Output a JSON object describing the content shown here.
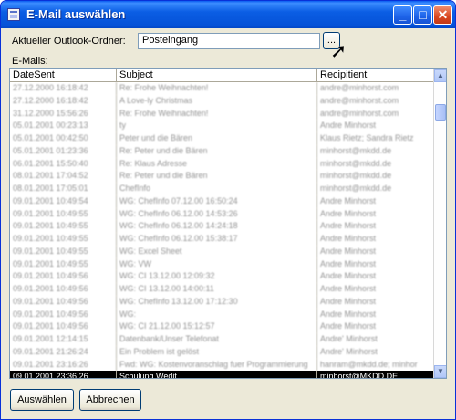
{
  "window": {
    "title": "E-Mail auswählen"
  },
  "captions": {
    "minimize": "_",
    "maximize": "□",
    "close": "✕"
  },
  "folder": {
    "label": "Aktueller Outlook-Ordner:",
    "value": "Posteingang",
    "browse_label": "..."
  },
  "list": {
    "label": "E-Mails:",
    "columns": [
      "DateSent",
      "Subject",
      "Recipitient"
    ],
    "rows": [
      {
        "date": "27.12.2000 16:18:42",
        "subject": "Re: Frohe Weihnachten!",
        "recipient": "andre@minhorst.com"
      },
      {
        "date": "27.12.2000 16:18:42",
        "subject": "A Love-ly Christmas",
        "recipient": "andre@minhorst.com"
      },
      {
        "date": "31.12.2000 15:56:26",
        "subject": "Re: Frohe Weihnachten!",
        "recipient": "andre@minhorst.com"
      },
      {
        "date": "05.01.2001 00:23:13",
        "subject": "ty",
        "recipient": "Andre Minhorst"
      },
      {
        "date": "05.01.2001 00:42:50",
        "subject": "Peter und die Bären",
        "recipient": "Klaus Rietz; Sandra Rietz"
      },
      {
        "date": "05.01.2001 01:23:36",
        "subject": "Re: Peter und die Bären",
        "recipient": "minhorst@mkdd.de"
      },
      {
        "date": "06.01.2001 15:50:40",
        "subject": "Re: Klaus Adresse",
        "recipient": "minhorst@mkdd.de"
      },
      {
        "date": "08.01.2001 17:04:52",
        "subject": "Re: Peter und die Bären",
        "recipient": "minhorst@mkdd.de"
      },
      {
        "date": "08.01.2001 17:05:01",
        "subject": "ChefInfo",
        "recipient": "minhorst@mkdd.de"
      },
      {
        "date": "09.01.2001 10:49:54",
        "subject": "WG: ChefInfo 07.12.00 16:50:24",
        "recipient": "Andre Minhorst"
      },
      {
        "date": "09.01.2001 10:49:55",
        "subject": "WG: ChefInfo 06.12.00 14:53:26",
        "recipient": "Andre Minhorst"
      },
      {
        "date": "09.01.2001 10:49:55",
        "subject": "WG: ChefInfo 06.12.00 14:24:18",
        "recipient": "Andre Minhorst"
      },
      {
        "date": "09.01.2001 10:49:55",
        "subject": "WG: ChefInfo 06.12.00 15:38:17",
        "recipient": "Andre Minhorst"
      },
      {
        "date": "09.01.2001 10:49:55",
        "subject": "WG: Excel Sheet",
        "recipient": "Andre Minhorst"
      },
      {
        "date": "09.01.2001 10:49:55",
        "subject": "WG: VW",
        "recipient": "Andre Minhorst"
      },
      {
        "date": "09.01.2001 10:49:56",
        "subject": "WG: CI 13.12.00 12:09:32",
        "recipient": "Andre Minhorst"
      },
      {
        "date": "09.01.2001 10:49:56",
        "subject": "WG: CI 13.12.00 14:00:11",
        "recipient": "Andre Minhorst"
      },
      {
        "date": "09.01.2001 10:49:56",
        "subject": "WG: ChefInfo 13.12.00 17:12:30",
        "recipient": "Andre Minhorst"
      },
      {
        "date": "09.01.2001 10:49:56",
        "subject": "WG:",
        "recipient": "Andre Minhorst"
      },
      {
        "date": "09.01.2001 10:49:56",
        "subject": "WG: CI 21.12.00 15:12:57",
        "recipient": "Andre Minhorst"
      },
      {
        "date": "09.01.2001 12:14:15",
        "subject": "Datenbank/Unser Telefonat",
        "recipient": "Andre' Minhorst"
      },
      {
        "date": "09.01.2001 21:26:24",
        "subject": "Ein Problem ist gelöst",
        "recipient": "Andre' Minhorst"
      },
      {
        "date": "09.01.2001 23:16:26",
        "subject": "Fwd: WG: Kostenvoranschlag fuer Programmierung",
        "recipient": "hanram@mkdd.de; minhor"
      },
      {
        "date": "09.01.2001 23:36:26",
        "subject": "Schulung Wedit",
        "recipient": "minhorst@MKDD.DE",
        "selected": true
      }
    ]
  },
  "buttons": {
    "select": "Auswählen",
    "cancel": "Abbrechen"
  }
}
